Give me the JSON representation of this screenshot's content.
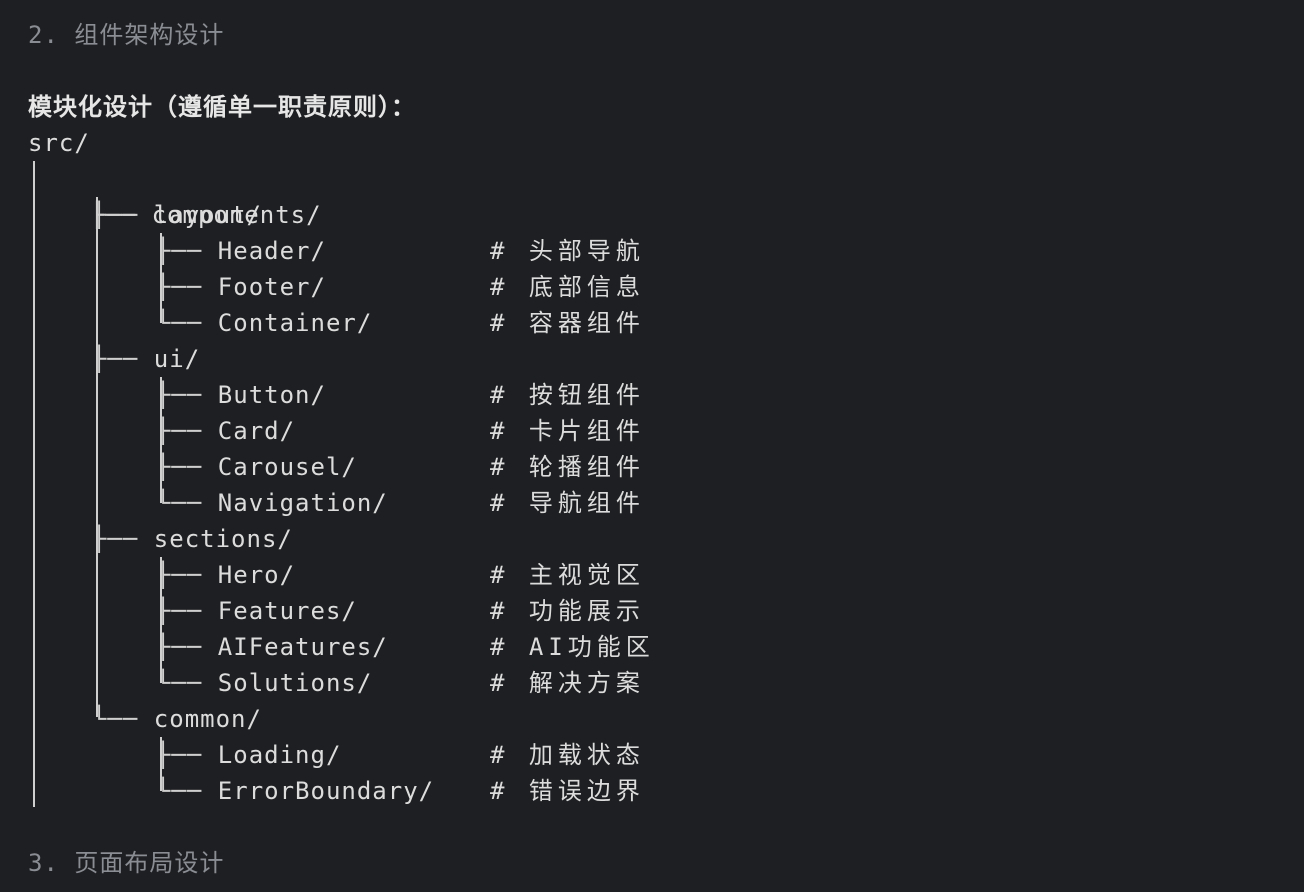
{
  "sections": {
    "prev_heading": "2. 组件架构设计",
    "next_heading": "3. 页面布局设计"
  },
  "intro": {
    "title": "模块化设计（遵循单一职责原则）：",
    "root": "src/"
  },
  "tree": {
    "components": "components/",
    "groups": [
      {
        "name": "layout/",
        "items": [
          {
            "name": "Header/",
            "comment": "# 头部导航"
          },
          {
            "name": "Footer/",
            "comment": "# 底部信息"
          },
          {
            "name": "Container/",
            "comment": "# 容器组件"
          }
        ]
      },
      {
        "name": "ui/",
        "items": [
          {
            "name": "Button/",
            "comment": "# 按钮组件"
          },
          {
            "name": "Card/",
            "comment": "# 卡片组件"
          },
          {
            "name": "Carousel/",
            "comment": "# 轮播组件"
          },
          {
            "name": "Navigation/",
            "comment": "# 导航组件"
          }
        ]
      },
      {
        "name": "sections/",
        "items": [
          {
            "name": "Hero/",
            "comment": "# 主视觉区"
          },
          {
            "name": "Features/",
            "comment": "# 功能展示"
          },
          {
            "name": "AIFeatures/",
            "comment": "# AI功能区"
          },
          {
            "name": "Solutions/",
            "comment": "# 解决方案"
          }
        ]
      },
      {
        "name": "common/",
        "items": [
          {
            "name": "Loading/",
            "comment": "# 加载状态"
          },
          {
            "name": "ErrorBoundary/",
            "comment": "# 错误边界"
          }
        ]
      }
    ]
  }
}
